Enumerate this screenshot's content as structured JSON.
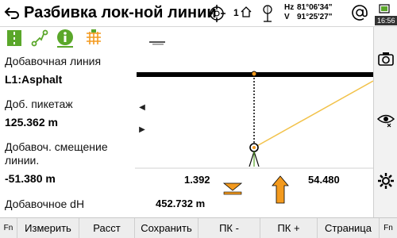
{
  "header": {
    "title": "Разбивка лок-ной линии",
    "face_count": "1",
    "hz_label": "Hz",
    "hz_value": "81°06'34\"",
    "v_label": "V",
    "v_value": "91°25'27\"",
    "time": "16:56"
  },
  "info": {
    "line_label": "Добавочная линия",
    "line_value": "L1:Asphalt",
    "chainage_label": "Доб. пикетаж",
    "chainage_value": "125.362 m",
    "offset_label_1": "Добавоч. смещение",
    "offset_label_2": "линии.",
    "offset_value": "-51.380 m",
    "dh_label": "Добавочное dH"
  },
  "readouts": {
    "left_value": "1.392",
    "right_value": "54.480",
    "bottom_value": "452.732 m"
  },
  "softkeys": {
    "fn_left": "Fn",
    "measure": "Измерить",
    "distance": "Расст",
    "save": "Сохранить",
    "pk_minus": "ПК -",
    "pk_plus": "ПК +",
    "page": "Страница",
    "fn_right": "Fn"
  },
  "colors": {
    "accent_green": "#5aa72a",
    "orange": "#f39a1e",
    "line_yellow": "#f2c24a"
  }
}
